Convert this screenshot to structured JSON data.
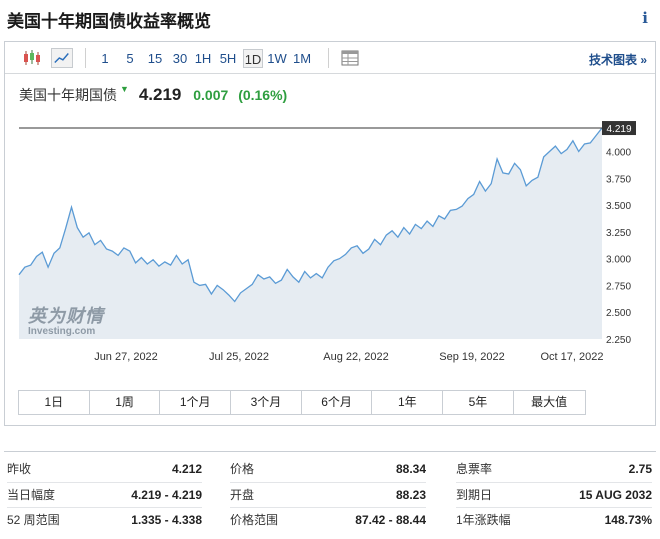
{
  "title": "美国十年期国债收益率概览",
  "info_icon": "info-icon",
  "toolbar": {
    "icons": [
      "candlestick-icon",
      "area-chart-icon",
      "table-icon"
    ],
    "periods": [
      "1",
      "5",
      "15",
      "30",
      "1H",
      "5H",
      "1D",
      "1W",
      "1M"
    ],
    "active_period": "1D",
    "tech_chart": "技术图表 »"
  },
  "quote": {
    "name": "美国十年期国债",
    "last": "4.219",
    "change": "0.007",
    "change_pct": "(0.16%)",
    "up_color": "#2e9e3f"
  },
  "watermark": {
    "cn": "英为财情",
    "en": "Investing.com"
  },
  "chart_data": {
    "type": "area",
    "x": [
      "Jun 27, 2022",
      "Jul 25, 2022",
      "Aug 22, 2022",
      "Sep 19, 2022",
      "Oct 17, 2022"
    ],
    "y_ticks": [
      "4.000",
      "3.750",
      "3.500",
      "3.250",
      "3.000",
      "2.750",
      "2.500",
      "2.250"
    ],
    "ylim": [
      2.25,
      4.35
    ],
    "current_value": 4.219,
    "current_label": "4.219",
    "values": [
      2.85,
      2.92,
      2.94,
      3.02,
      3.06,
      2.92,
      3.05,
      3.1,
      3.28,
      3.48,
      3.29,
      3.2,
      3.24,
      3.13,
      3.17,
      3.09,
      3.07,
      3.03,
      3.1,
      3.07,
      2.96,
      3.01,
      2.95,
      2.99,
      2.93,
      2.97,
      2.94,
      3.03,
      2.95,
      2.99,
      2.78,
      2.75,
      2.76,
      2.67,
      2.75,
      2.71,
      2.66,
      2.6,
      2.68,
      2.72,
      2.76,
      2.85,
      2.81,
      2.83,
      2.77,
      2.8,
      2.9,
      2.83,
      2.78,
      2.88,
      2.82,
      2.86,
      2.82,
      2.92,
      2.98,
      3.0,
      3.04,
      3.1,
      3.12,
      3.05,
      3.09,
      3.18,
      3.13,
      3.22,
      3.26,
      3.2,
      3.29,
      3.23,
      3.32,
      3.28,
      3.35,
      3.3,
      3.4,
      3.37,
      3.45,
      3.46,
      3.49,
      3.56,
      3.6,
      3.72,
      3.63,
      3.7,
      3.93,
      3.8,
      3.79,
      3.89,
      3.83,
      3.68,
      3.73,
      3.76,
      3.95,
      4.0,
      4.05,
      3.98,
      4.02,
      4.1,
      4.0,
      4.07,
      4.08,
      4.15,
      4.219
    ],
    "fill_color": "#e6ecf2",
    "line_color": "#5b9bd5"
  },
  "range_buttons": [
    "1日",
    "1周",
    "1个月",
    "3个月",
    "6个月",
    "1年",
    "5年",
    "最大值"
  ],
  "stats": [
    [
      {
        "label": "昨收",
        "value": "4.212"
      },
      {
        "label": "当日幅度",
        "value": "4.219 - 4.219"
      },
      {
        "label": "52 周范围",
        "value": "1.335 - 4.338"
      }
    ],
    [
      {
        "label": "价格",
        "value": "88.34"
      },
      {
        "label": "开盘",
        "value": "88.23"
      },
      {
        "label": "价格范围",
        "value": "87.42 - 88.44"
      }
    ],
    [
      {
        "label": "息票率",
        "value": "2.75"
      },
      {
        "label": "到期日",
        "value": "15 AUG 2032"
      },
      {
        "label": "1年涨跌幅",
        "value": "148.73%"
      }
    ]
  ]
}
